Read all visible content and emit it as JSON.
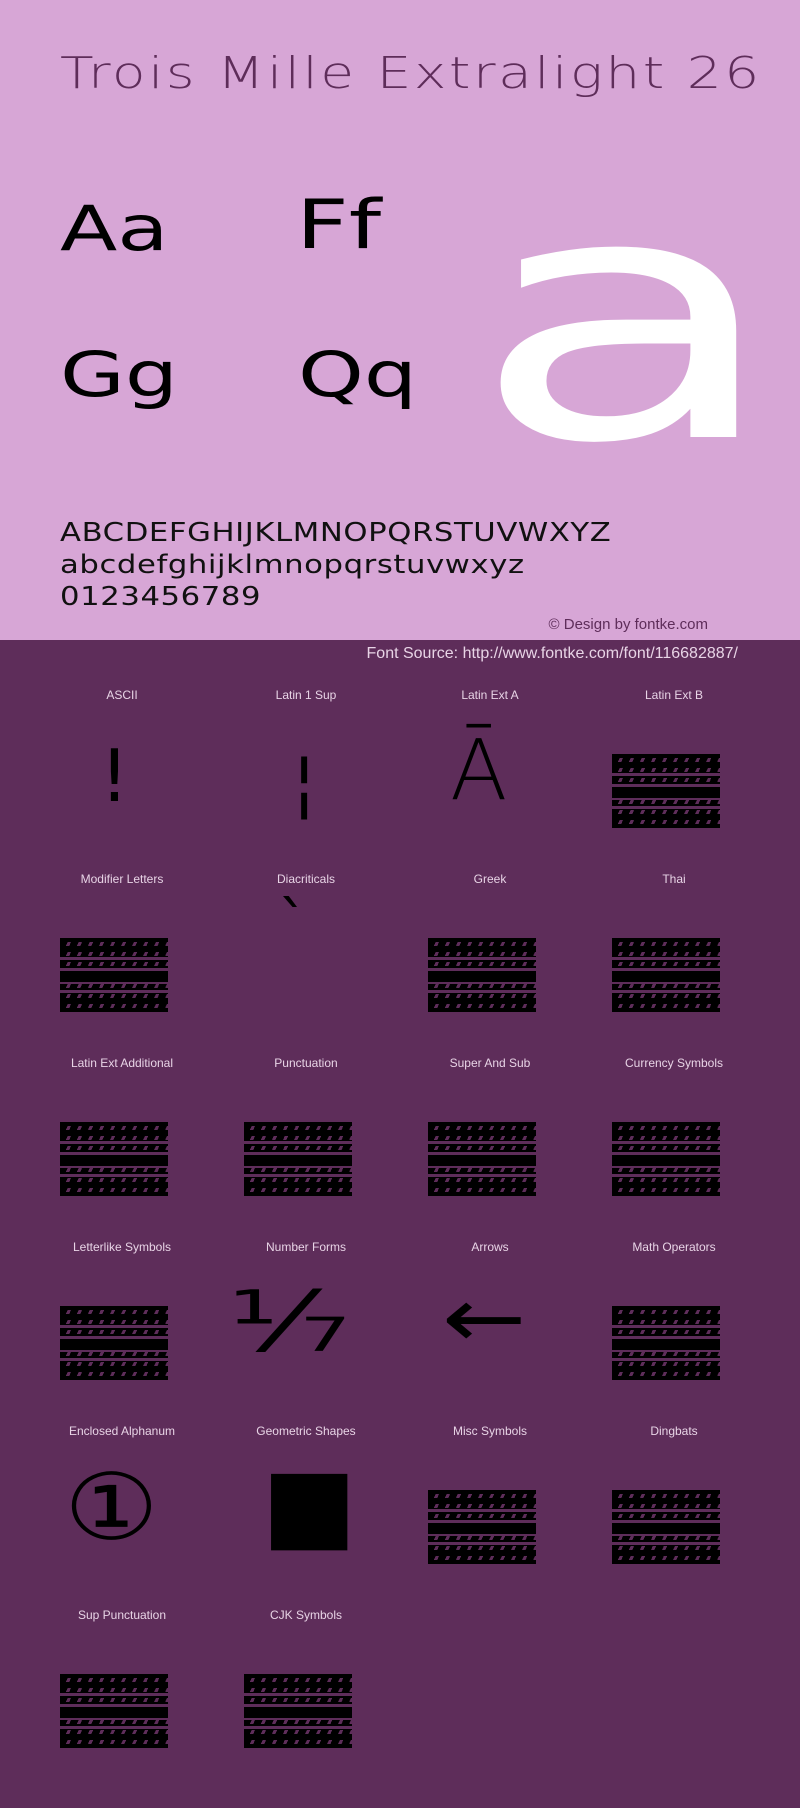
{
  "header": {
    "title": "Trois Mille Extralight 26",
    "specimen_pairs": [
      "Aa",
      "Ff",
      "Gg",
      "Qq"
    ],
    "big_glyph": "a",
    "uppercase": "ABCDEFGHIJKLMNOPQRSTUVWXYZ",
    "lowercase": "abcdefghijklmnopqrstuvwxyz",
    "digits": "0123456789",
    "credit": "© Design by fontke.com",
    "source": "Font Source: http://www.fontke.com/font/116682887/"
  },
  "colors": {
    "top_background": "#d7a6d6",
    "bottom_background": "#5e2d5a",
    "big_glyph": "#ffffff",
    "label_text": "#e8d4e6"
  },
  "blocks": [
    {
      "label": "ASCII",
      "glyph": "!",
      "rendered": true
    },
    {
      "label": "Latin 1 Sup",
      "glyph": "¦",
      "rendered": true
    },
    {
      "label": "Latin Ext A",
      "glyph": "Ā",
      "rendered": true
    },
    {
      "label": "Latin Ext B",
      "glyph": "",
      "rendered": false
    },
    {
      "label": "Modifier Letters",
      "glyph": "",
      "rendered": false
    },
    {
      "label": "Diacriticals",
      "glyph": "`",
      "rendered": true
    },
    {
      "label": "Greek",
      "glyph": "",
      "rendered": false
    },
    {
      "label": "Thai",
      "glyph": "",
      "rendered": false
    },
    {
      "label": "Latin Ext Additional",
      "glyph": "",
      "rendered": false
    },
    {
      "label": "Punctuation",
      "glyph": "",
      "rendered": false
    },
    {
      "label": "Super And Sub",
      "glyph": "",
      "rendered": false
    },
    {
      "label": "Currency Symbols",
      "glyph": "",
      "rendered": false
    },
    {
      "label": "Letterlike Symbols",
      "glyph": "",
      "rendered": false
    },
    {
      "label": "Number Forms",
      "glyph": "⅐",
      "rendered": true
    },
    {
      "label": "Arrows",
      "glyph": "←",
      "rendered": true
    },
    {
      "label": "Math Operators",
      "glyph": "",
      "rendered": false
    },
    {
      "label": "Enclosed Alphanum",
      "glyph": "①",
      "rendered": true
    },
    {
      "label": "Geometric Shapes",
      "glyph": "■",
      "rendered": true
    },
    {
      "label": "Misc Symbols",
      "glyph": "",
      "rendered": false
    },
    {
      "label": "Dingbats",
      "glyph": "",
      "rendered": false
    },
    {
      "label": "Sup Punctuation",
      "glyph": "",
      "rendered": false
    },
    {
      "label": "CJK Symbols",
      "glyph": "",
      "rendered": false
    }
  ]
}
